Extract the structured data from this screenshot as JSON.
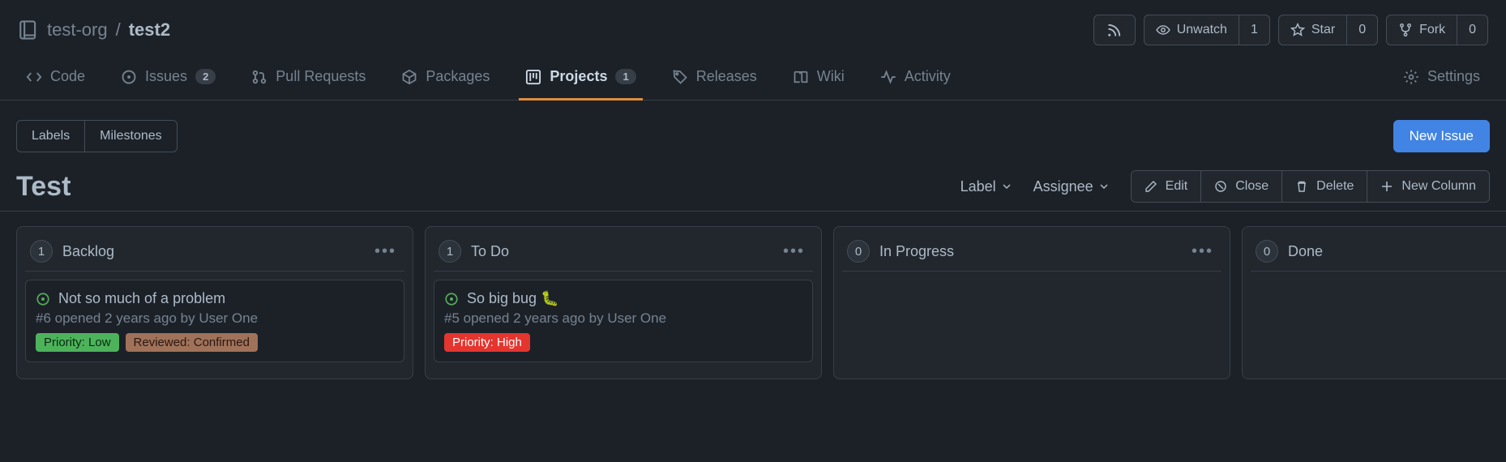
{
  "repo": {
    "org": "test-org",
    "separator": "/",
    "name": "test2"
  },
  "header_actions": {
    "unwatch": {
      "label": "Unwatch",
      "count": "1"
    },
    "star": {
      "label": "Star",
      "count": "0"
    },
    "fork": {
      "label": "Fork",
      "count": "0"
    }
  },
  "tabs": {
    "code": "Code",
    "issues": {
      "label": "Issues",
      "count": "2"
    },
    "pulls": "Pull Requests",
    "packages": "Packages",
    "projects": {
      "label": "Projects",
      "count": "1"
    },
    "releases": "Releases",
    "wiki": "Wiki",
    "activity": "Activity",
    "settings": "Settings"
  },
  "subnav": {
    "labels": "Labels",
    "milestones": "Milestones",
    "new_issue": "New Issue"
  },
  "project": {
    "title": "Test",
    "filters": {
      "label": "Label",
      "assignee": "Assignee"
    },
    "actions": {
      "edit": "Edit",
      "close": "Close",
      "delete": "Delete",
      "new_column": "New Column"
    }
  },
  "board": {
    "columns": [
      {
        "id": "backlog",
        "title": "Backlog",
        "count": "1",
        "show_menu": true,
        "cards": [
          {
            "title": "Not so much of a problem",
            "meta": "#6 opened 2 years ago by User One",
            "labels": [
              {
                "text": "Priority: Low",
                "class": "priority-low"
              },
              {
                "text": "Reviewed: Confirmed",
                "class": "reviewed-confirmed"
              }
            ]
          }
        ]
      },
      {
        "id": "todo",
        "title": "To Do",
        "count": "1",
        "show_menu": true,
        "cards": [
          {
            "title": "So big bug 🐛",
            "meta": "#5 opened 2 years ago by User One",
            "labels": [
              {
                "text": "Priority: High",
                "class": "priority-high"
              }
            ]
          }
        ]
      },
      {
        "id": "in-progress",
        "title": "In Progress",
        "count": "0",
        "show_menu": true,
        "cards": []
      },
      {
        "id": "done",
        "title": "Done",
        "count": "0",
        "show_menu": false,
        "cards": []
      }
    ]
  }
}
